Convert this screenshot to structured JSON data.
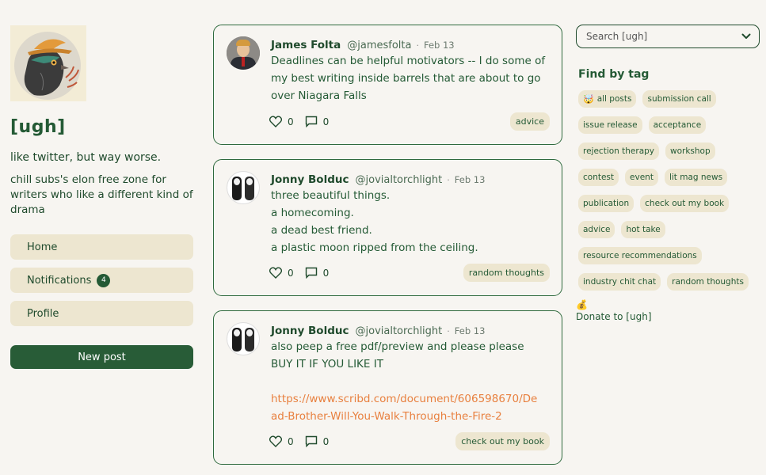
{
  "sidebar": {
    "site_title": "[ugh]",
    "tagline": "like twitter, but way worse.",
    "description": "chill subs's elon free zone for writers who like a different kind of drama",
    "nav": [
      {
        "label": "Home"
      },
      {
        "label": "Notifications",
        "badge": "4"
      },
      {
        "label": "Profile"
      }
    ],
    "new_post_label": "New post"
  },
  "posts": [
    {
      "author": "James Folta",
      "handle": "@jamesfolta",
      "date": "Feb 13",
      "lines": [
        "Deadlines can be helpful motivators -- I do some of my best writing inside barrels that are about to go over Niagara Falls"
      ],
      "likes": "0",
      "comments": "0",
      "tag": "advice"
    },
    {
      "author": "Jonny Bolduc",
      "handle": "@jovialtorchlight",
      "date": "Feb 13",
      "lines": [
        "three beautiful things.",
        "a homecoming.",
        "a dead best friend.",
        "a plastic moon ripped from the ceiling."
      ],
      "likes": "0",
      "comments": "0",
      "tag": "random thoughts"
    },
    {
      "author": "Jonny Bolduc",
      "handle": "@jovialtorchlight",
      "date": "Feb 13",
      "text": "also peep a free pdf/preview and please please BUY IT IF YOU LIKE IT",
      "link": "https://www.scribd.com/document/606598670/Dead-Brother-Will-You-Walk-Through-the-Fire-2",
      "likes": "0",
      "comments": "0",
      "tag": "check out my book"
    }
  ],
  "right": {
    "search_placeholder": "Search [ugh]",
    "find_title": "Find by tag",
    "tags": [
      {
        "label": "all posts",
        "emoji": "🤯"
      },
      {
        "label": "submission call"
      },
      {
        "label": "issue release"
      },
      {
        "label": "acceptance"
      },
      {
        "label": "rejection therapy"
      },
      {
        "label": "workshop"
      },
      {
        "label": "contest"
      },
      {
        "label": "event"
      },
      {
        "label": "lit mag news"
      },
      {
        "label": "publication"
      },
      {
        "label": "check out my book"
      },
      {
        "label": "advice"
      },
      {
        "label": "hot take"
      },
      {
        "label": "resource recommendations"
      },
      {
        "label": "industry chit chat"
      },
      {
        "label": "random thoughts"
      }
    ],
    "donate_icon": "💰",
    "donate_label": "Donate to [ugh]"
  },
  "icons": {
    "like": "heart-icon",
    "comment": "comment-icon",
    "chevron": "chevron-down-icon"
  },
  "colors": {
    "accent": "#285c37",
    "pill": "#ede6d0",
    "link": "#e8803f",
    "background": "#f7f5f1"
  }
}
